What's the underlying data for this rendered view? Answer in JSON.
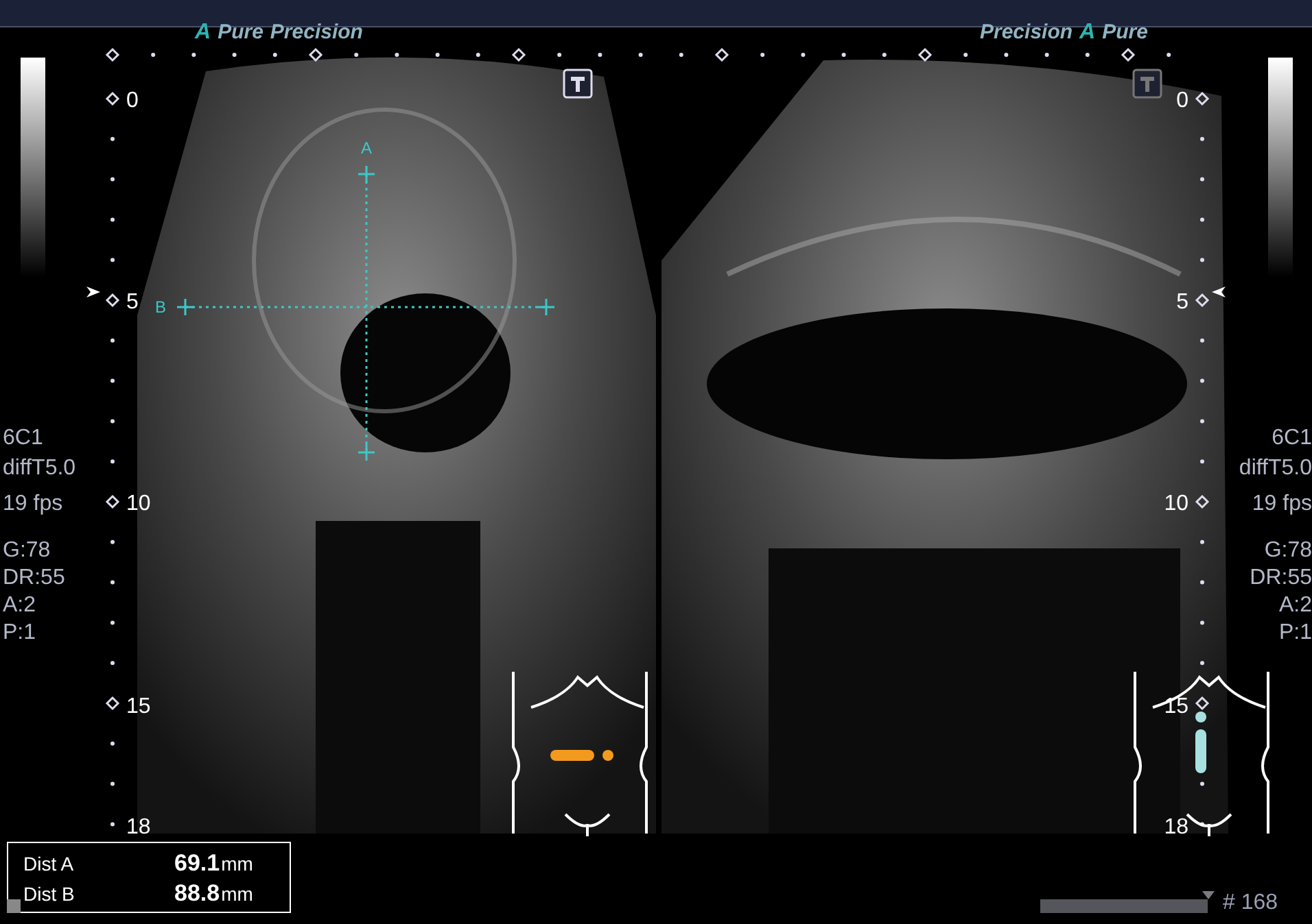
{
  "left_panel": {
    "brand": [
      "A",
      "Pure",
      "Precision"
    ],
    "depth_labels": [
      "0",
      "5",
      "10",
      "15",
      "18"
    ],
    "body_marker": {
      "color": "#f39a1e",
      "kind": "transverse"
    }
  },
  "right_panel": {
    "brand": [
      "Precision",
      "A",
      "Pure"
    ],
    "depth_labels": [
      "0",
      "5",
      "10",
      "15",
      "18"
    ],
    "body_marker": {
      "color": "#a8e0e0",
      "kind": "longitudinal"
    }
  },
  "calipers": [
    {
      "label": "A",
      "kind": "vertical"
    },
    {
      "label": "B",
      "kind": "horizontal"
    }
  ],
  "params_left": [
    "6C1",
    "diffT5.0",
    "19 fps",
    "G:78",
    "DR:55",
    "A:2",
    "P:1"
  ],
  "params_right": [
    "6C1",
    "diffT5.0",
    "19 fps",
    "G:78",
    "DR:55",
    "A:2",
    "P:1"
  ],
  "measurements": [
    {
      "label": "Dist A",
      "value": "69.1",
      "unit": "mm"
    },
    {
      "label": "Dist B",
      "value": "88.8",
      "unit": "mm"
    }
  ],
  "cine": {
    "frame": "# 168"
  }
}
